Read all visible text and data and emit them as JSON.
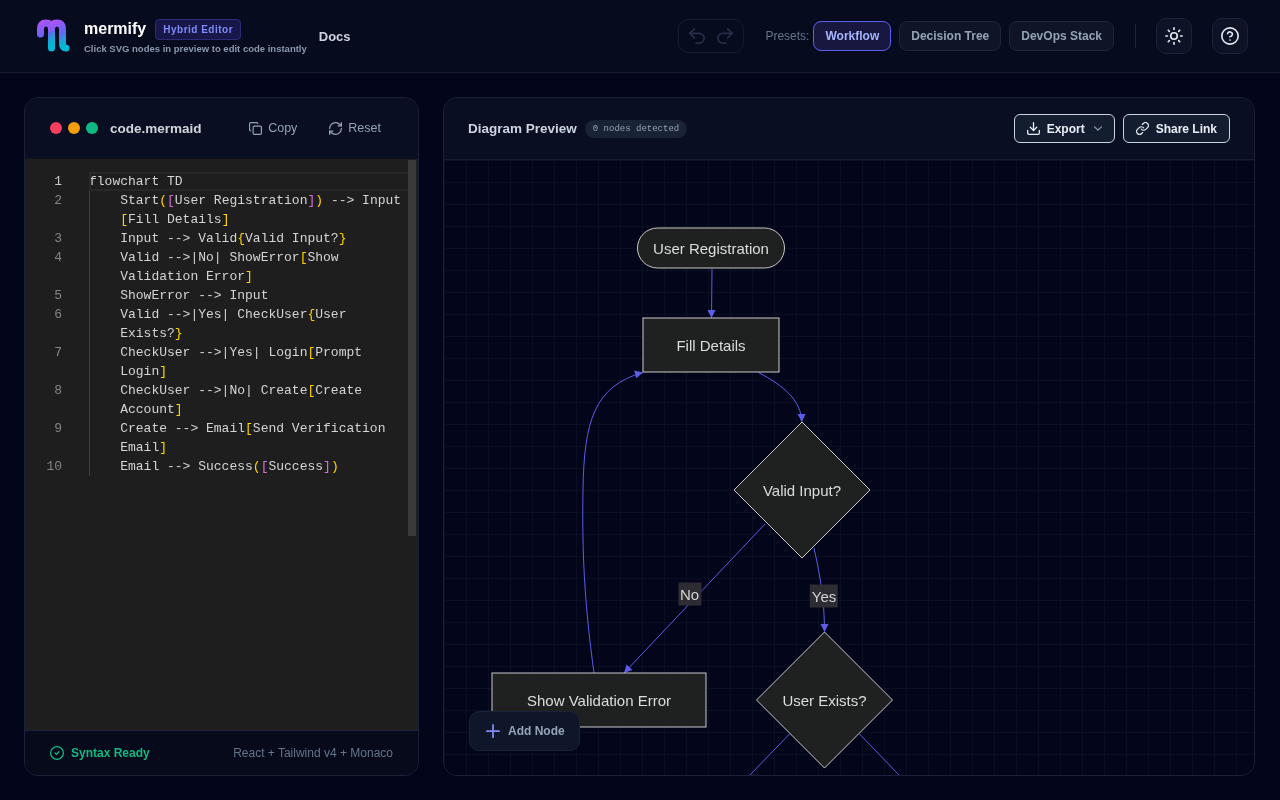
{
  "header": {
    "brand": "mermify",
    "badge": "Hybrid Editor",
    "tagline": "Click SVG nodes in preview to edit code instantly",
    "nav": [
      {
        "label": "Docs"
      }
    ]
  },
  "toolbar": {
    "history": [
      {
        "kind": "undo",
        "disabled": true
      },
      {
        "kind": "redo",
        "disabled": true
      }
    ],
    "presets_label": "Presets:",
    "presets": [
      {
        "label": "Workflow",
        "selected": true
      },
      {
        "label": "Decision Tree",
        "selected": false
      },
      {
        "label": "DevOps Stack",
        "selected": false
      }
    ],
    "actions": [
      {
        "kind": "theme"
      },
      {
        "kind": "help"
      }
    ]
  },
  "editor": {
    "filename": "code.mermaid",
    "window_dots": [
      {
        "color": "#f43f5e"
      },
      {
        "color": "#f59e0b"
      },
      {
        "color": "#10b981"
      }
    ],
    "actions": [
      {
        "kind": "copy",
        "label": "Copy"
      },
      {
        "kind": "reset",
        "label": "Reset"
      }
    ],
    "lines": [
      {
        "number": "1",
        "rows": [
          "flowchart TD"
        ],
        "current": true,
        "children": [
          {
            "number": "2",
            "rows": [
              "Start([User Registration]) --> Input",
              "[Fill Details]"
            ],
            "current": false
          },
          {
            "number": "3",
            "rows": [
              "Input --> Valid{Valid Input?}"
            ],
            "current": false
          },
          {
            "number": "4",
            "rows": [
              "Valid -->|No| ShowError[Show",
              "Validation Error]"
            ],
            "current": false
          },
          {
            "number": "5",
            "rows": [
              "ShowError --> Input"
            ],
            "current": false
          },
          {
            "number": "6",
            "rows": [
              "Valid -->|Yes| CheckUser{User",
              "Exists?}"
            ],
            "current": false
          },
          {
            "number": "7",
            "rows": [
              "CheckUser -->|Yes| Login[Prompt",
              "Login]"
            ],
            "current": false
          },
          {
            "number": "8",
            "rows": [
              "CheckUser -->|No| Create[Create",
              "Account]"
            ],
            "current": false
          },
          {
            "number": "9",
            "rows": [
              "Create --> Email[Send Verification",
              "Email]"
            ],
            "current": false
          },
          {
            "number": "10",
            "rows": [
              "Email --> Success([Success])"
            ],
            "current": false
          }
        ]
      }
    ],
    "status": {
      "kind": "ok",
      "label": "Syntax Ready"
    },
    "stack": "React + Tailwind v4 + Monaco"
  },
  "preview": {
    "title": "Diagram Preview",
    "badge": "0 nodes detected",
    "actions": [
      {
        "kind": "export",
        "label": "Export"
      },
      {
        "kind": "share",
        "label": "Share Link"
      }
    ],
    "nodes": [
      {
        "label": "User Registration",
        "kind": "stadium"
      },
      {
        "label": "Fill Details",
        "kind": "process"
      },
      {
        "label": "Valid Input?",
        "kind": "decision"
      },
      {
        "label": "Show Validation Error",
        "kind": "process"
      },
      {
        "label": "User Exists?",
        "kind": "decision"
      }
    ],
    "edges": [
      {
        "kind": "arrow"
      },
      {
        "kind": "arrow"
      },
      {
        "kind": "arrow",
        "label": "No"
      },
      {
        "kind": "arrow"
      },
      {
        "kind": "arrow",
        "label": "Yes"
      },
      {
        "kind": "cut"
      },
      {
        "kind": "cut"
      }
    ],
    "add_button": "Add Node"
  }
}
